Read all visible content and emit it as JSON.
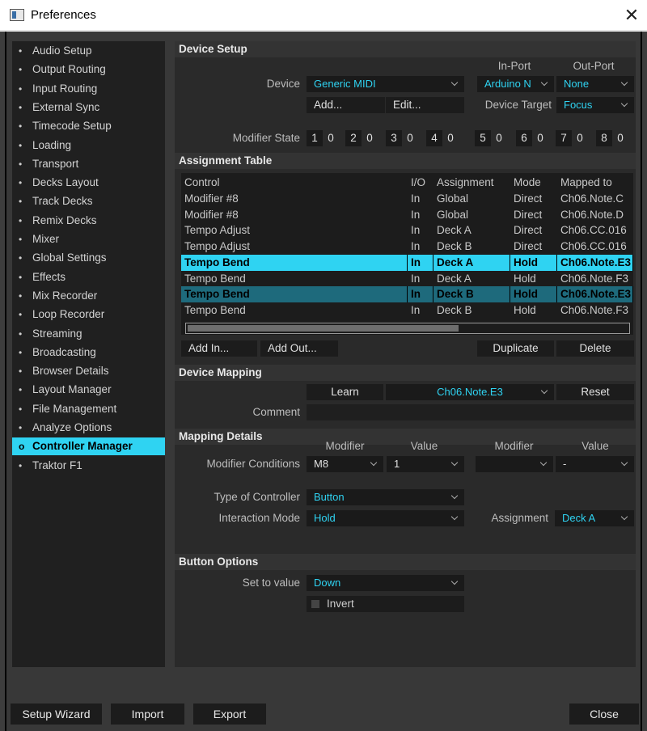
{
  "window": {
    "title": "Preferences"
  },
  "sidebar": {
    "items": [
      {
        "label": "Audio Setup"
      },
      {
        "label": "Output Routing"
      },
      {
        "label": "Input Routing"
      },
      {
        "label": "External Sync"
      },
      {
        "label": "Timecode Setup"
      },
      {
        "label": "Loading"
      },
      {
        "label": "Transport"
      },
      {
        "label": "Decks Layout"
      },
      {
        "label": "Track Decks"
      },
      {
        "label": "Remix Decks"
      },
      {
        "label": "Mixer"
      },
      {
        "label": "Global Settings"
      },
      {
        "label": "Effects"
      },
      {
        "label": "Mix Recorder"
      },
      {
        "label": "Loop Recorder"
      },
      {
        "label": "Streaming"
      },
      {
        "label": "Broadcasting"
      },
      {
        "label": "Browser Details"
      },
      {
        "label": "Layout Manager"
      },
      {
        "label": "File Management"
      },
      {
        "label": "Analyze Options"
      },
      {
        "label": "Controller Manager",
        "active": true
      },
      {
        "label": "Traktor F1"
      }
    ]
  },
  "device_setup": {
    "heading": "Device Setup",
    "in_port_label": "In-Port",
    "out_port_label": "Out-Port",
    "device_label": "Device",
    "device_value": "Generic MIDI",
    "in_port_value": "Arduino N",
    "out_port_value": "None",
    "add_label": "Add...",
    "edit_label": "Edit...",
    "device_target_label": "Device Target",
    "device_target_value": "Focus",
    "modifier_state_label": "Modifier State",
    "modifiers": [
      {
        "n": "1",
        "v": "0"
      },
      {
        "n": "2",
        "v": "0"
      },
      {
        "n": "3",
        "v": "0"
      },
      {
        "n": "4",
        "v": "0"
      },
      {
        "n": "5",
        "v": "0"
      },
      {
        "n": "6",
        "v": "0"
      },
      {
        "n": "7",
        "v": "0"
      },
      {
        "n": "8",
        "v": "0"
      }
    ]
  },
  "assignment_table": {
    "heading": "Assignment Table",
    "columns": [
      "Control",
      "I/O",
      "Assignment",
      "Mode",
      "Mapped to"
    ],
    "rows": [
      [
        "Modifier #8",
        "In",
        "Global",
        "Direct",
        "Ch06.Note.C"
      ],
      [
        "Modifier #8",
        "In",
        "Global",
        "Direct",
        "Ch06.Note.D"
      ],
      [
        "Tempo Adjust",
        "In",
        "Deck A",
        "Direct",
        "Ch06.CC.016"
      ],
      [
        "Tempo Adjust",
        "In",
        "Deck B",
        "Direct",
        "Ch06.CC.016"
      ],
      [
        "Tempo Bend",
        "In",
        "Deck A",
        "Hold",
        "Ch06.Note.E3"
      ],
      [
        "Tempo Bend",
        "In",
        "Deck A",
        "Hold",
        "Ch06.Note.F3"
      ],
      [
        "Tempo Bend",
        "In",
        "Deck B",
        "Hold",
        "Ch06.Note.E3"
      ],
      [
        "Tempo Bend",
        "In",
        "Deck B",
        "Hold",
        "Ch06.Note.F3"
      ]
    ],
    "add_in_label": "Add In...",
    "add_out_label": "Add Out...",
    "duplicate_label": "Duplicate",
    "delete_label": "Delete"
  },
  "device_mapping": {
    "heading": "Device Mapping",
    "learn_label": "Learn",
    "mapped_value": "Ch06.Note.E3",
    "reset_label": "Reset",
    "comment_label": "Comment",
    "comment_value": ""
  },
  "mapping_details": {
    "heading": "Mapping Details",
    "modifier_col1": "Modifier",
    "value_col1": "Value",
    "modifier_col2": "Modifier",
    "value_col2": "Value",
    "modifier_conditions_label": "Modifier Conditions",
    "cond1_modifier": "M8",
    "cond1_value": "1",
    "cond2_modifier": "",
    "cond2_value": "-",
    "type_of_controller_label": "Type of Controller",
    "type_of_controller_value": "Button",
    "interaction_mode_label": "Interaction Mode",
    "interaction_mode_value": "Hold",
    "assignment_label": "Assignment",
    "assignment_value": "Deck A"
  },
  "button_options": {
    "heading": "Button Options",
    "set_to_value_label": "Set to value",
    "set_to_value": "Down",
    "invert_label": "Invert",
    "invert_checked": false
  },
  "footer": {
    "setup_wizard": "Setup Wizard",
    "import": "Import",
    "export": "Export",
    "close": "Close"
  },
  "colors": {
    "accent": "#2fd3f2",
    "selected_row_dim": "#1e6a7c",
    "panel_bg": "#2a2a2a",
    "field_bg": "#1a1a1a"
  }
}
